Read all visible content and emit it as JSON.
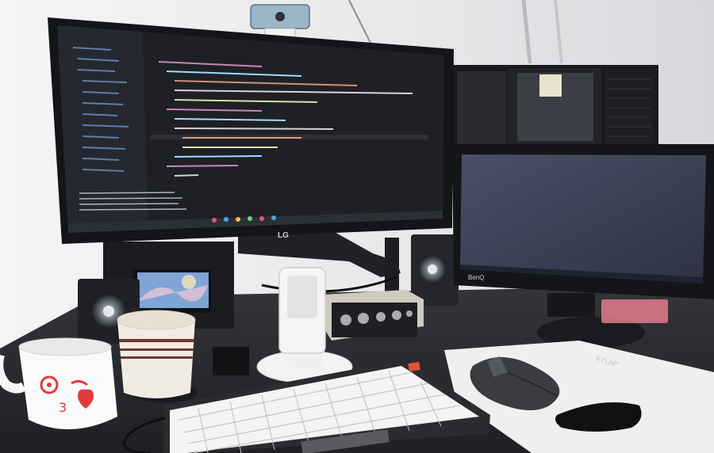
{
  "scene": {
    "monitor_left_brand": "LG",
    "monitor_right_brand": "BenQ",
    "mouse_pad_brand": "XYLAP"
  },
  "colors": {
    "wall": "#e9eaec",
    "desk": "#2a2b2e",
    "monitor_bezel": "#141518",
    "code_bg": "#1e2026",
    "benq_screen": "#3a3f52",
    "keyboard_keys": "#f4f4f2",
    "mug_heart": "#e23a3a",
    "cup_stripe": "#6b3a2c",
    "mouse": "#3a3c40"
  }
}
